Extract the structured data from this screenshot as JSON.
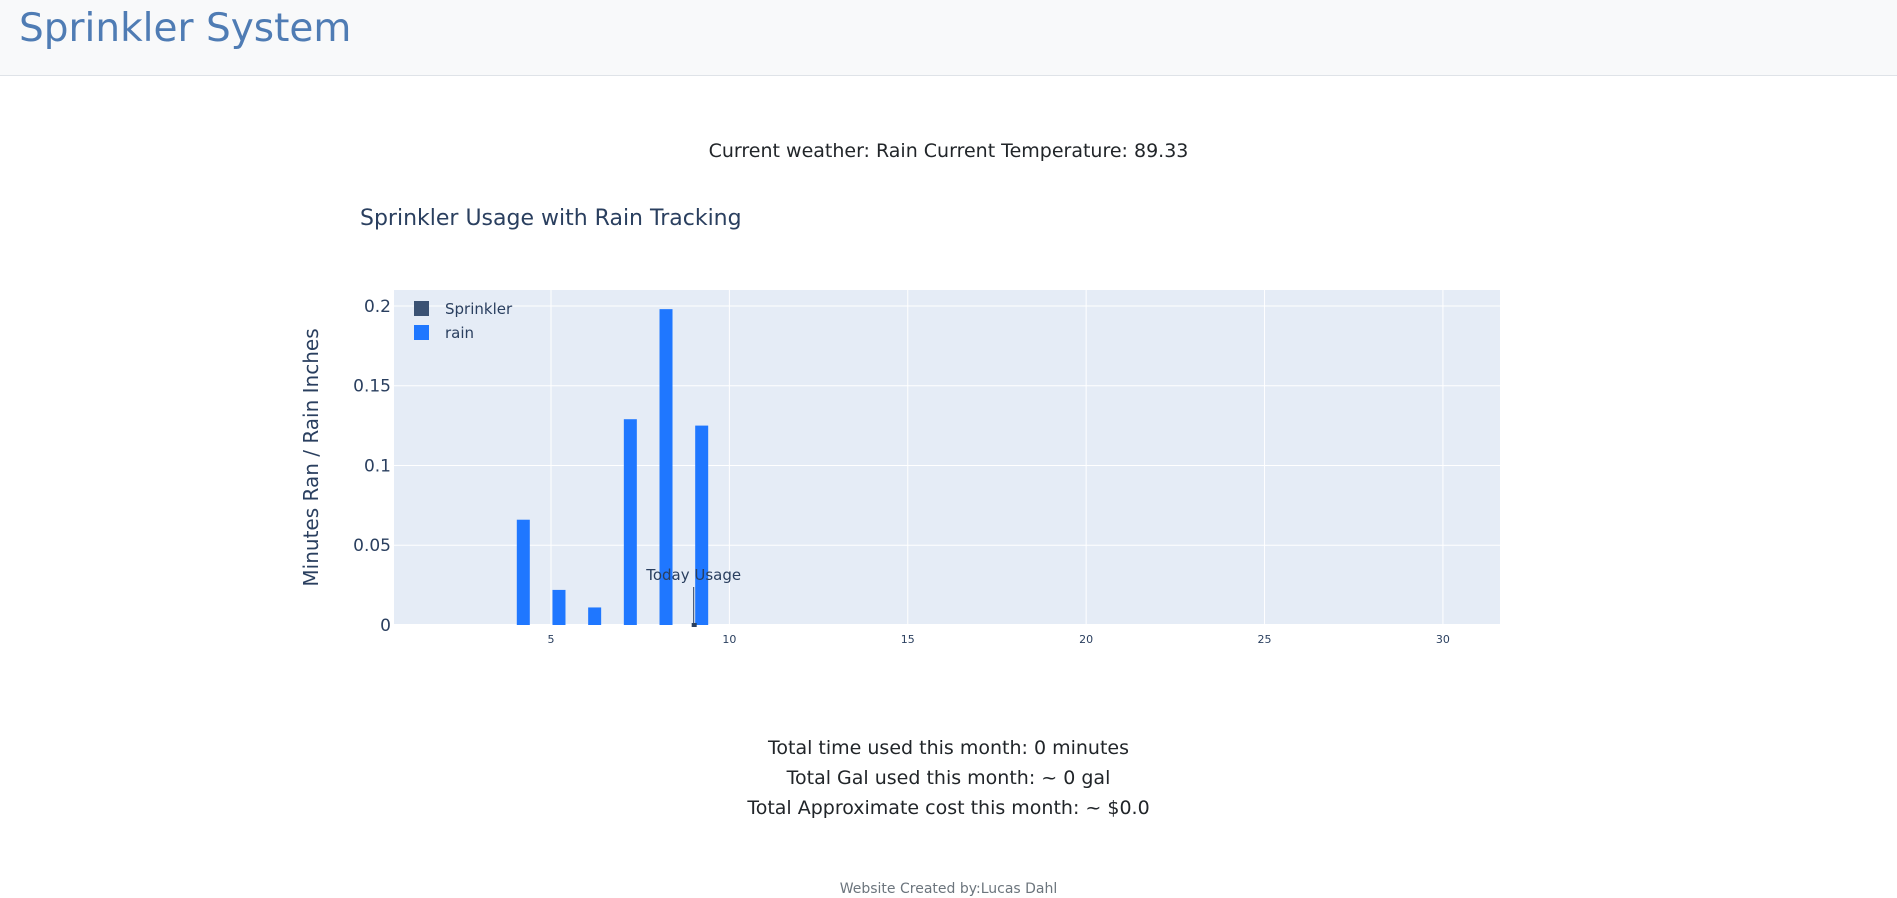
{
  "navbar": {
    "brand": "Sprinkler System"
  },
  "weather_line": "Current weather: Rain Current Temperature: 89.33",
  "chart_data": {
    "type": "bar",
    "title": "Sprinkler Usage with Rain Tracking",
    "ylabel": "Minutes Ran / Rain Inches",
    "xlabel": "",
    "xlim": [
      0.6,
      31.6
    ],
    "ylim": [
      0,
      0.21
    ],
    "xticks": [
      5,
      10,
      15,
      20,
      25,
      30
    ],
    "yticks": [
      {
        "value": 0,
        "label": "0"
      },
      {
        "value": 0.05,
        "label": "0.05"
      },
      {
        "value": 0.1,
        "label": "0.1"
      },
      {
        "value": 0.15,
        "label": "0.15"
      },
      {
        "value": 0.2,
        "label": "0.2"
      }
    ],
    "legend_position": "top-left",
    "series": [
      {
        "name": "Sprinkler",
        "color": "#3b5273",
        "x": [],
        "y": []
      },
      {
        "name": "rain",
        "color": "#1f77ff",
        "x": [
          4,
          5,
          6,
          7,
          8,
          9
        ],
        "y": [
          0.066,
          0.022,
          0.011,
          0.129,
          0.198,
          0.125
        ]
      }
    ],
    "annotation": {
      "text": "Today Usage",
      "x": 9
    }
  },
  "stats": {
    "time_line": "Total time used this month: 0 minutes",
    "gal_line": "Total Gal used this month: ~ 0 gal",
    "cost_line": "Total Approximate cost this month: ~ $0.0"
  },
  "footer": {
    "credit": "Website Created by:Lucas Dahl"
  }
}
